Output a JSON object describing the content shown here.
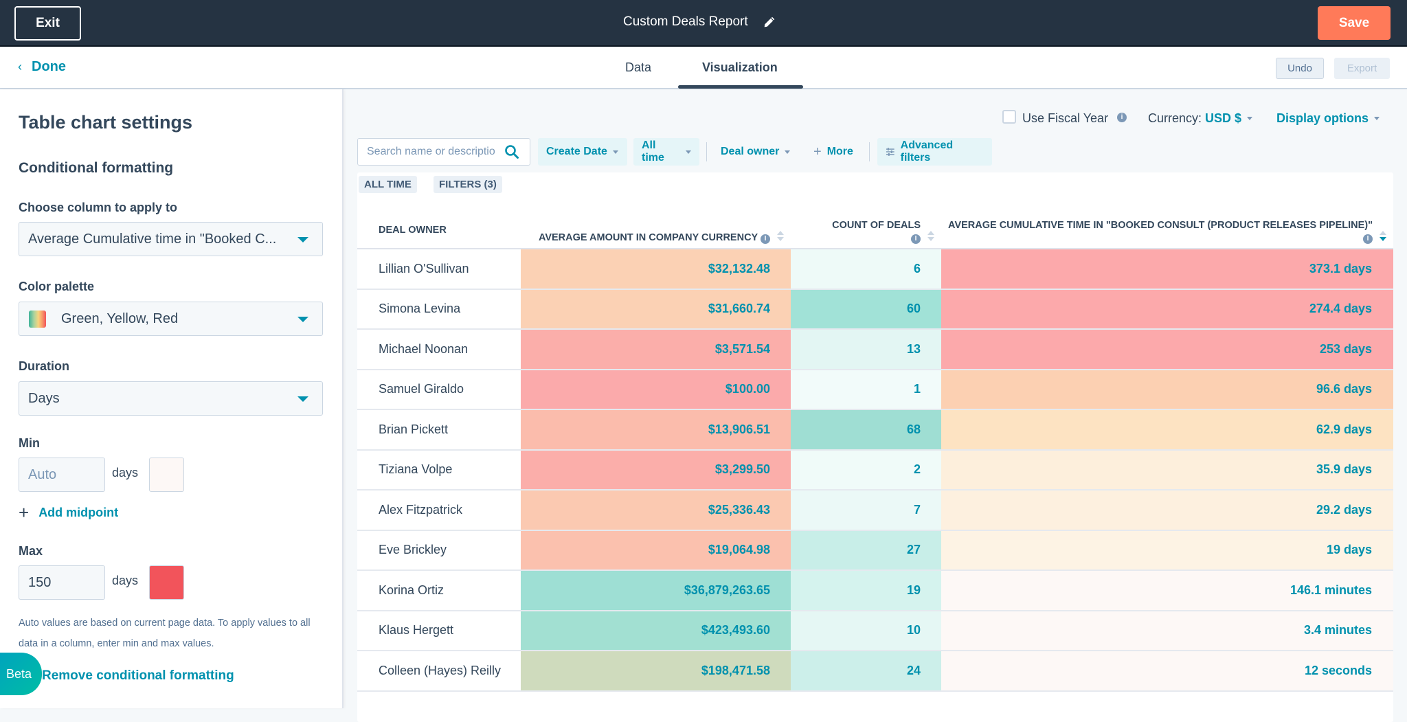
{
  "topbar": {
    "exit_label": "Exit",
    "report_title": "Custom Deals Report",
    "save_label": "Save"
  },
  "subbar": {
    "done_label": "Done",
    "tabs": [
      {
        "label": "Data",
        "active": false
      },
      {
        "label": "Visualization",
        "active": true
      }
    ],
    "undo_label": "Undo",
    "export_label": "Export"
  },
  "settings": {
    "title": "Table chart settings",
    "section": "Conditional formatting",
    "column_label": "Choose column to apply to",
    "column_value": "Average Cumulative time in \"Booked C...",
    "palette_label": "Color palette",
    "palette_value": "Green, Yellow, Red",
    "duration_label": "Duration",
    "duration_value": "Days",
    "min_label": "Min",
    "min_placeholder": "Auto",
    "min_value": "",
    "min_unit": "days",
    "min_color": "#fdf8f6",
    "add_midpoint_label": "Add midpoint",
    "max_label": "Max",
    "max_value": "150",
    "max_unit": "days",
    "max_color": "#f2545b",
    "help_text": "Auto values are based on current page data. To apply values to all data in a column, enter min and max values.",
    "remove_label": "Remove conditional formatting",
    "beta_label": "Beta"
  },
  "options": {
    "fiscal_year_label": "Use Fiscal Year",
    "fiscal_year_checked": false,
    "currency_label": "Currency:",
    "currency_value": "USD $",
    "display_options_label": "Display options"
  },
  "filters": {
    "search_placeholder": "Search name or descriptio",
    "create_date_label": "Create Date",
    "all_time_label": "All time",
    "deal_owner_label": "Deal owner",
    "more_label": "More",
    "advanced_label": "Advanced filters",
    "chips": [
      "ALL TIME",
      "FILTERS (3)"
    ]
  },
  "table": {
    "columns": [
      "DEAL OWNER",
      "AVERAGE AMOUNT IN COMPANY CURRENCY",
      "COUNT OF DEALS",
      "AVERAGE CUMULATIVE TIME IN \"BOOKED CONSULT (PRODUCT RELEASES PIPELINE)\""
    ],
    "sorted_column": 3,
    "sort_direction": "descending",
    "rows": [
      {
        "owner": "Lillian O'Sullivan",
        "amount": "$32,132.48",
        "count": "6",
        "time": "373.1 days",
        "amount_bg": "#fbd1b4",
        "count_bg": "#eefaf8",
        "time_bg": "#fca9ab"
      },
      {
        "owner": "Simona Levina",
        "amount": "$31,660.74",
        "count": "60",
        "time": "274.4 days",
        "amount_bg": "#fbd1b4",
        "count_bg": "#a1e2d7",
        "time_bg": "#fca9ab"
      },
      {
        "owner": "Michael Noonan",
        "amount": "$3,571.54",
        "count": "13",
        "time": "253 days",
        "amount_bg": "#fbaeaa",
        "count_bg": "#e3f6f3",
        "time_bg": "#fca9ab"
      },
      {
        "owner": "Samuel Giraldo",
        "amount": "$100.00",
        "count": "1",
        "time": "96.6 days",
        "amount_bg": "#fbaaab",
        "count_bg": "#f2fbfa",
        "time_bg": "#fcd0b2"
      },
      {
        "owner": "Brian Pickett",
        "amount": "$13,906.51",
        "count": "68",
        "time": "62.9 days",
        "amount_bg": "#fbbcac",
        "count_bg": "#9fded3",
        "time_bg": "#fde3c2"
      },
      {
        "owner": "Tiziana Volpe",
        "amount": "$3,299.50",
        "count": "2",
        "time": "35.9 days",
        "amount_bg": "#fbaeaa",
        "count_bg": "#f0fbf9",
        "time_bg": "#fdefdc"
      },
      {
        "owner": "Alex Fitzpatrick",
        "amount": "$25,336.43",
        "count": "7",
        "time": "29.2 days",
        "amount_bg": "#fbc9b1",
        "count_bg": "#ebf9f7",
        "time_bg": "#fdf0df"
      },
      {
        "owner": "Eve Brickley",
        "amount": "$19,064.98",
        "count": "27",
        "time": "19 days",
        "amount_bg": "#fbc1ae",
        "count_bg": "#c8eee8",
        "time_bg": "#fdf3e4"
      },
      {
        "owner": "Korina Ortiz",
        "amount": "$36,879,263.65",
        "count": "19",
        "time": "146.1 minutes",
        "amount_bg": "#9edfd4",
        "count_bg": "#d5f3ee",
        "time_bg": "#fdf8f6"
      },
      {
        "owner": "Klaus Hergett",
        "amount": "$423,493.60",
        "count": "10",
        "time": "3.4 minutes",
        "amount_bg": "#a2e0d2",
        "count_bg": "#e5f7f4",
        "time_bg": "#fdf8f6"
      },
      {
        "owner": "Colleen (Hayes) Reilly",
        "amount": "$198,471.58",
        "count": "24",
        "time": "12 seconds",
        "amount_bg": "#cfdbbd",
        "count_bg": "#ccefea",
        "time_bg": "#fdf8f6"
      }
    ]
  },
  "colors": {
    "topbar_bg": "#253342",
    "accent": "#0091ae",
    "save_bg": "#ff7a59",
    "text_primary": "#33475b"
  }
}
